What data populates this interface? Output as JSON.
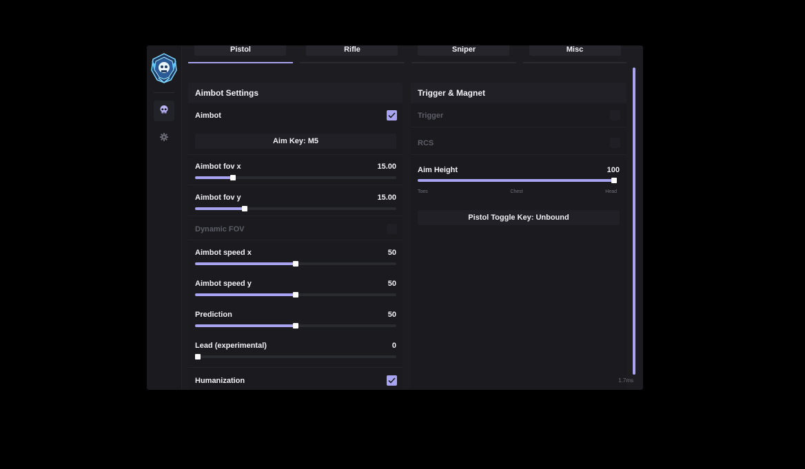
{
  "tabs": [
    {
      "label": "Pistol",
      "active": true
    },
    {
      "label": "Rifle",
      "active": false
    },
    {
      "label": "Sniper",
      "active": false
    },
    {
      "label": "Misc",
      "active": false
    }
  ],
  "sidebar": {
    "items": [
      {
        "icon": "skull-icon",
        "active": true
      },
      {
        "icon": "gear-icon",
        "active": false
      }
    ]
  },
  "aimbot": {
    "title": "Aimbot Settings",
    "aimbot_label": "Aimbot",
    "aimbot_checked": true,
    "aim_key_label": "Aim Key: M5",
    "fov_x": {
      "label": "Aimbot fov x",
      "value": "15.00",
      "fraction": 0.18
    },
    "fov_y": {
      "label": "Aimbot fov y",
      "value": "15.00",
      "fraction": 0.24
    },
    "dynamic_fov_label": "Dynamic FOV",
    "speed_x": {
      "label": "Aimbot speed x",
      "value": "50",
      "fraction": 0.5
    },
    "speed_y": {
      "label": "Aimbot speed y",
      "value": "50",
      "fraction": 0.5
    },
    "prediction": {
      "label": "Prediction",
      "value": "50",
      "fraction": 0.5
    },
    "lead": {
      "label": "Lead (experimental)",
      "value": "0",
      "fraction": 0.0
    },
    "humanization_label": "Humanization",
    "humanization_checked": true
  },
  "trigger": {
    "title": "Trigger & Magnet",
    "trigger_label": "Trigger",
    "rcs_label": "RCS",
    "aim_height": {
      "label": "Aim Height",
      "value": "100",
      "fraction": 1.0
    },
    "ticks": [
      "Toes",
      "Chest",
      "Head"
    ],
    "toggle_key_label": "Pistol Toggle Key: Unbound"
  },
  "status": {
    "frame_time": "1.7ms"
  },
  "colors": {
    "accent": "#a9a4f2",
    "background": "#1c1c21",
    "panel": "#1a1a1f"
  }
}
